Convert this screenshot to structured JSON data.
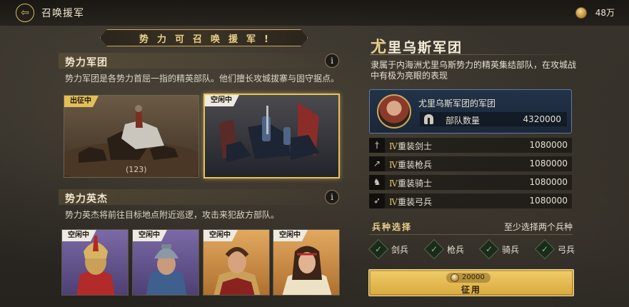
{
  "header": {
    "title": "召唤援军",
    "currency_value": "48万"
  },
  "left": {
    "banner": "势力可召唤援军!",
    "legion_section": {
      "title": "势力军团",
      "desc": "势力军团是各势力首屈一指的精英部队。他们擅长攻城拔寨与固守据点。",
      "cards": [
        {
          "tag": "出征中",
          "count": "(123)"
        },
        {
          "tag": "空闲中"
        }
      ]
    },
    "hero_section": {
      "title": "势力英杰",
      "desc": "势力英杰将前往目标地点附近巡逻，攻击来犯敌方部队。",
      "heroes": [
        {
          "tag": "空闲中"
        },
        {
          "tag": "空闲中"
        },
        {
          "tag": "空闲中"
        },
        {
          "tag": "空闲中"
        }
      ]
    },
    "info_glyph": "i"
  },
  "right": {
    "legion_name_first": "尤",
    "legion_name_rest": "里乌斯军团",
    "legion_desc": "隶属于内海洲尤里乌斯势力的精英集结部队，在攻城战中有极为亮眼的表现",
    "army": {
      "title": "尤里乌斯军团的军团",
      "label": "部队数量",
      "value": "4320000"
    },
    "units": [
      {
        "tier": "Ⅳ",
        "name": "重装剑士",
        "value": "1080000",
        "icon": "sword-icon"
      },
      {
        "tier": "Ⅳ",
        "name": "重装枪兵",
        "value": "1080000",
        "icon": "spear-icon"
      },
      {
        "tier": "Ⅳ",
        "name": "重装骑士",
        "value": "1080000",
        "icon": "horse-icon"
      },
      {
        "tier": "Ⅳ",
        "name": "重装弓兵",
        "value": "1080000",
        "icon": "bow-icon"
      }
    ],
    "troop_select": {
      "title": "兵种选择",
      "hint": "至少选择两个兵种",
      "options": [
        "剑兵",
        "枪兵",
        "骑兵",
        "弓兵"
      ]
    },
    "recruit": {
      "cost": "20000",
      "label": "征用"
    }
  },
  "colors": {
    "accent_gold": "#e3bf58",
    "selected_border": "#e6c25b",
    "army_box": "#223248",
    "check_green": "#7fc75d"
  }
}
